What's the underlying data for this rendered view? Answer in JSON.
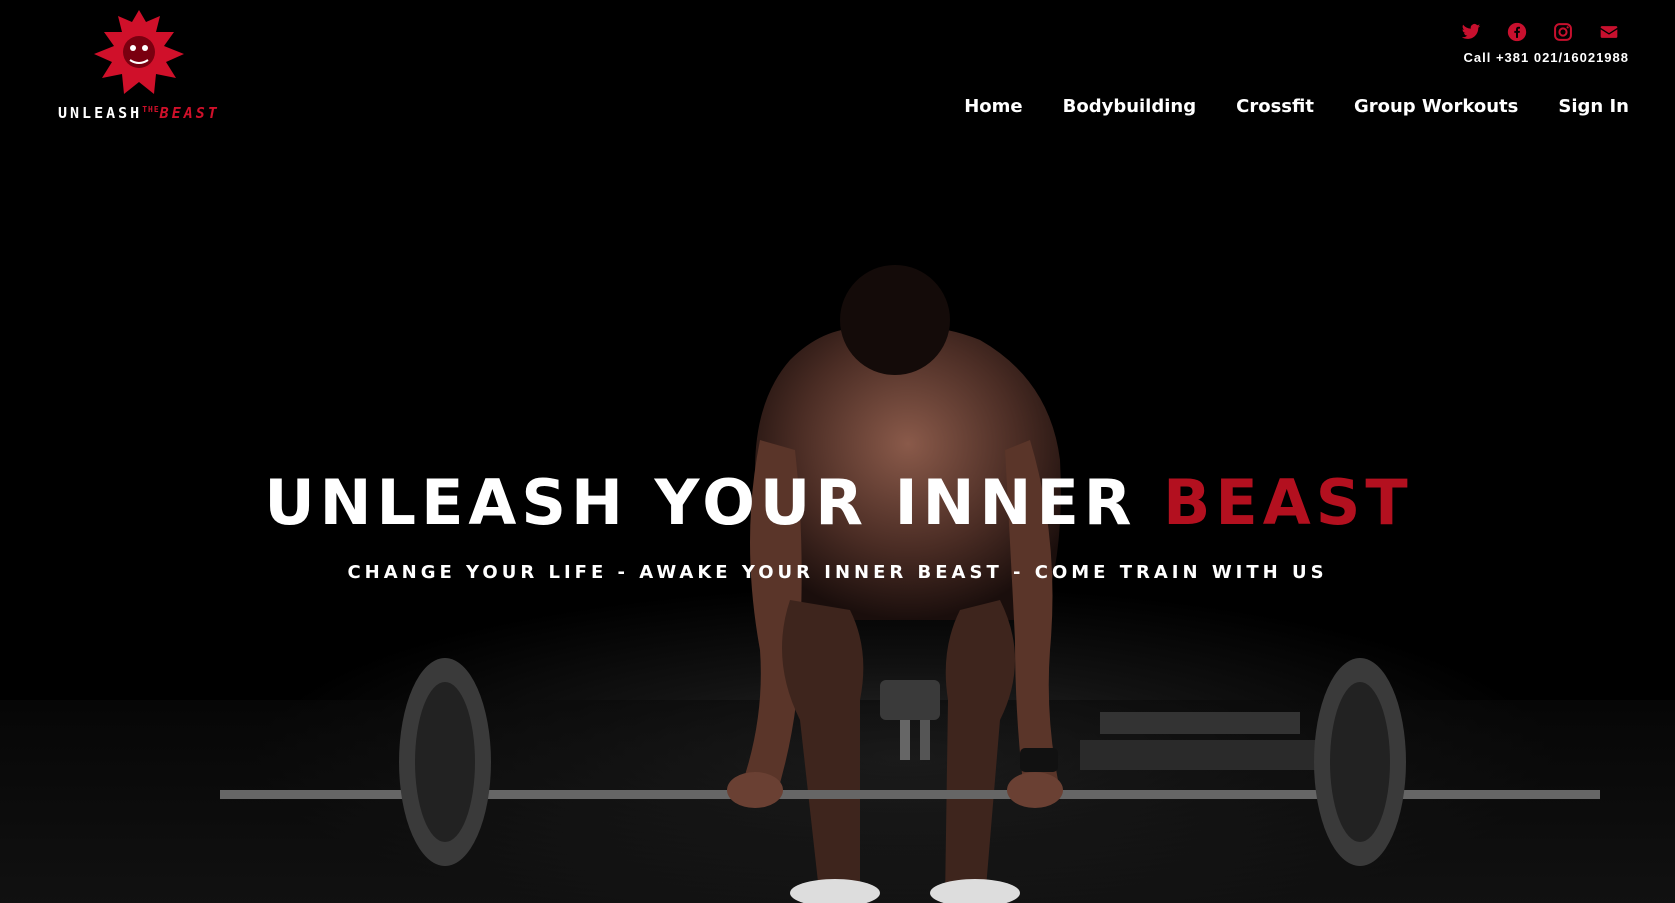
{
  "brand": {
    "logo_word1": "UNLEASH",
    "logo_small": "THE",
    "logo_word2": "BEAST",
    "accent_color": "#b3101f"
  },
  "header": {
    "social_icons": [
      "twitter-icon",
      "facebook-icon",
      "instagram-icon",
      "envelope-icon"
    ],
    "call_text": "Call +381 021/16021988",
    "nav": {
      "home": "Home",
      "bodybuilding": "Bodybuilding",
      "crossfit": "Crossfit",
      "group_workouts": "Group Workouts",
      "sign_in": "Sign In"
    }
  },
  "hero": {
    "title_main": "UNLEASH YOUR INNER ",
    "title_accent": "BEAST",
    "subtitle": "CHANGE YOUR LIFE - AWAKE YOUR INNER BEAST - COME TRAIN WITH US"
  }
}
